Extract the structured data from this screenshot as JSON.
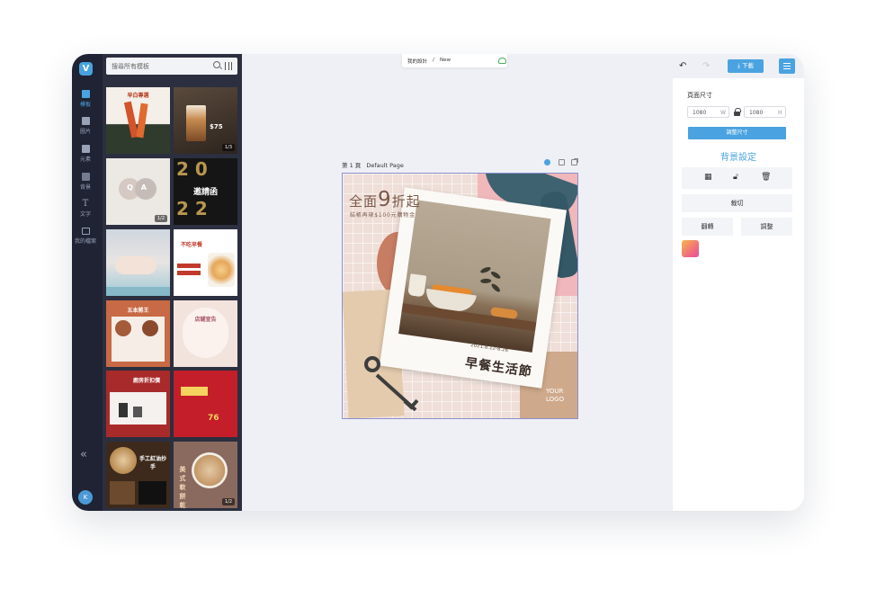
{
  "rail": {
    "logo": "V",
    "items": [
      {
        "label": "模板",
        "icon": "template-icon"
      },
      {
        "label": "圖片",
        "icon": "image-icon"
      },
      {
        "label": "元素",
        "icon": "elements-icon"
      },
      {
        "label": "背景",
        "icon": "background-icon"
      },
      {
        "label": "文字",
        "icon": "text-icon"
      },
      {
        "label": "我的檔案",
        "icon": "folder-icon"
      }
    ],
    "collapse": "«",
    "avatar": "K"
  },
  "templates": {
    "search_placeholder": "搜尋所有模板",
    "tiles": [
      {
        "title": "早白專選",
        "badge": ""
      },
      {
        "title": "$75",
        "badge": "1/3"
      },
      {
        "title": "Q A",
        "badge": "1/2"
      },
      {
        "title": "邀請函",
        "badge": ""
      },
      {
        "title": "",
        "badge": ""
      },
      {
        "title": "不吃早餐",
        "badge": ""
      },
      {
        "title": "五本將王",
        "badge": ""
      },
      {
        "title": "店鋪宣告",
        "badge": ""
      },
      {
        "title": "廚房折扣價",
        "badge": ""
      },
      {
        "title": "76",
        "badge": ""
      },
      {
        "title": "手工紅油抄手",
        "badge": ""
      },
      {
        "title": "美式軟餅乾",
        "badge": "1/2"
      }
    ]
  },
  "breadcrumb": {
    "root": "我的設計",
    "sep": "/",
    "current": "New"
  },
  "page": {
    "label": "第 1 頁",
    "name": "Default Page",
    "design": {
      "promo_prefix": "全面",
      "promo_number": "9",
      "promo_suffix": "折起",
      "promo_sub": "結帳再現$100元購物金",
      "date": "2021.8.12-8.26",
      "headline": "早餐生活節",
      "logo_line1": "YOUR",
      "logo_line2": "LOGO"
    }
  },
  "right_panel": {
    "download": "下載",
    "page_size_label": "頁面尺寸",
    "width": "1080",
    "width_unit": "W",
    "height": "1080",
    "height_unit": "H",
    "resize_button": "調整尺寸",
    "section_title": "背景設定",
    "crop": "裁切",
    "flip": "翻轉",
    "adjust": "調整"
  },
  "colors": {
    "accent": "#4aa3e0",
    "rail_bg": "#1f2333",
    "panel_bg": "#2b2f3f",
    "workspace_bg": "#eef0f5"
  }
}
